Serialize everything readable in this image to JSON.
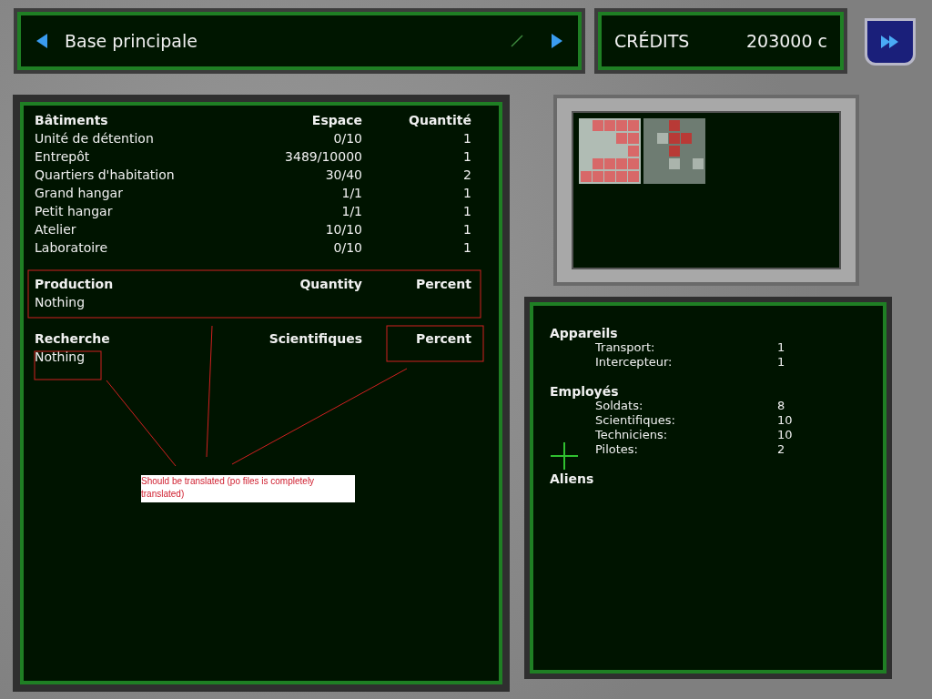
{
  "header": {
    "base_name": "Base principale",
    "credits_label": "CRÉDITS",
    "credits_value": "203000 c"
  },
  "buildings": {
    "columns": [
      "Bâtiments",
      "Espace",
      "Quantité"
    ],
    "rows": [
      [
        "Unité de détention",
        "0/10",
        "1"
      ],
      [
        "Entrepôt",
        "3489/10000",
        "1"
      ],
      [
        "Quartiers d'habitation",
        "30/40",
        "2"
      ],
      [
        "Grand hangar",
        "1/1",
        "1"
      ],
      [
        "Petit hangar",
        "1/1",
        "1"
      ],
      [
        "Atelier",
        "10/10",
        "1"
      ],
      [
        "Laboratoire",
        "0/10",
        "1"
      ]
    ]
  },
  "production": {
    "columns": [
      "Production",
      "Quantity",
      "Percent"
    ],
    "empty": "Nothing"
  },
  "research": {
    "columns": [
      "Recherche",
      "Scientifiques",
      "Percent"
    ],
    "empty": "Nothing"
  },
  "summary": {
    "sections": [
      {
        "title": "Appareils",
        "rows": [
          {
            "label": "Transport:",
            "value": "1"
          },
          {
            "label": "Intercepteur:",
            "value": "1"
          }
        ]
      },
      {
        "title": "Employés",
        "rows": [
          {
            "label": "Soldats:",
            "value": "8"
          },
          {
            "label": "Scientifiques:",
            "value": "10"
          },
          {
            "label": "Techniciens:",
            "value": "10"
          },
          {
            "label": "Pilotes:",
            "value": "2"
          }
        ]
      },
      {
        "title": "Aliens"
      }
    ]
  },
  "annotation": {
    "note": "Should be translated (po files is completely translated)"
  }
}
